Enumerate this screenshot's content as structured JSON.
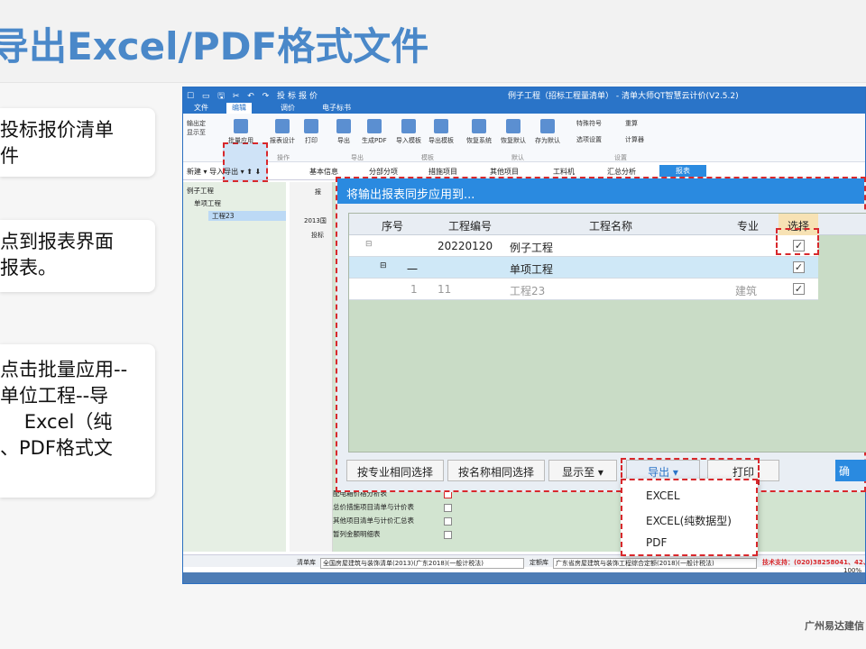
{
  "slide": {
    "title": "导出Excel/PDF格式文件",
    "cards": [
      {
        "lines": [
          "投标报价清单",
          "件"
        ]
      },
      {
        "lines": [
          "点到报表界面",
          "报表。"
        ]
      },
      {
        "lines": [
          "点击批量应用--",
          "单位工程--导",
          "    Excel（纯",
          "、PDF格式文"
        ]
      }
    ],
    "watermark": "广州易达建信"
  },
  "app": {
    "title": "例子工程（招标工程量清单） - 清单大师QT智慧云计价(V2.5.2)",
    "quick_access": "☐ ▭ 🖫 ✂ ↶ ↷ 投标报价",
    "menu": [
      "文件",
      "编辑",
      "调价",
      "电子标书"
    ],
    "active_menu": "编辑",
    "ribbon": [
      {
        "label": "输出定",
        "sub": "显示至"
      },
      {
        "label": "批量应用"
      },
      {
        "label": "报表设计"
      },
      {
        "label": "打印"
      },
      {
        "label": "导出"
      },
      {
        "label": "生成PDF"
      },
      {
        "label": "导入模板"
      },
      {
        "label": "导出模板"
      },
      {
        "label": "恢复系统"
      },
      {
        "label": "恢复默认"
      },
      {
        "label": "存为默认"
      },
      {
        "label": "特殊符号"
      },
      {
        "label": "选项设置"
      },
      {
        "label": "重算"
      },
      {
        "label": "计算器"
      }
    ],
    "ribbon_groups": [
      "操作",
      "导出",
      "模板",
      "默认",
      "设置"
    ],
    "toolbar_left": "新建 ▾ 导入导出 ▾ ⬆ ⬇",
    "nav_tabs": [
      "基本信息",
      "分部分项",
      "措施项目",
      "其他项目",
      "工料机",
      "汇总分析",
      "报表"
    ],
    "active_tab": "报表",
    "tree": [
      "例子工程",
      "单项工程",
      "工程23"
    ],
    "mid": [
      "报",
      "2013国",
      "投标"
    ],
    "report_list": [
      {
        "name": "配电箱价格分析表",
        "checked": true
      },
      {
        "name": "总价措施项目清单与计价表",
        "checked": false
      },
      {
        "name": "其他项目清单与计价汇总表",
        "checked": false
      },
      {
        "name": "暂列金额明细表",
        "checked": false
      }
    ],
    "status": {
      "qingdan_label": "清单库",
      "qingdan_value": "全国房屋建筑与装饰清单(2013)(广东2018)(一般计税法)",
      "dinge_label": "定额库",
      "dinge_value": "广东省房屋建筑与装饰工程综合定额(2018)(一般计税法)",
      "support": "技术支持：(020)38258041、42、",
      "zoom": "100%"
    }
  },
  "dialog": {
    "title": "将输出报表同步应用到...",
    "columns": [
      "序号",
      "工程编号",
      "工程名称",
      "专业",
      "选择"
    ],
    "rows": [
      {
        "seq": "",
        "code": "20220120",
        "name": "例子工程",
        "major": "",
        "checked": "✓"
      },
      {
        "seq": "一",
        "code": "",
        "name": "单项工程",
        "major": "",
        "checked": "✓"
      },
      {
        "seq": "1",
        "code": "11",
        "name": "工程23",
        "major": "建筑",
        "checked": "✓"
      }
    ],
    "buttons": {
      "by_major": "按专业相同选择",
      "by_name": "按名称相同选择",
      "show_to": "显示至 ▾",
      "export": "导出 ▾",
      "print": "打印",
      "confirm": "确"
    },
    "export_menu": [
      "EXCEL",
      "EXCEL(纯数据型)",
      "PDF"
    ]
  },
  "colors": {
    "accent": "#2a8ae0",
    "highlight": "#d8282c",
    "title": "#4a88c9"
  }
}
